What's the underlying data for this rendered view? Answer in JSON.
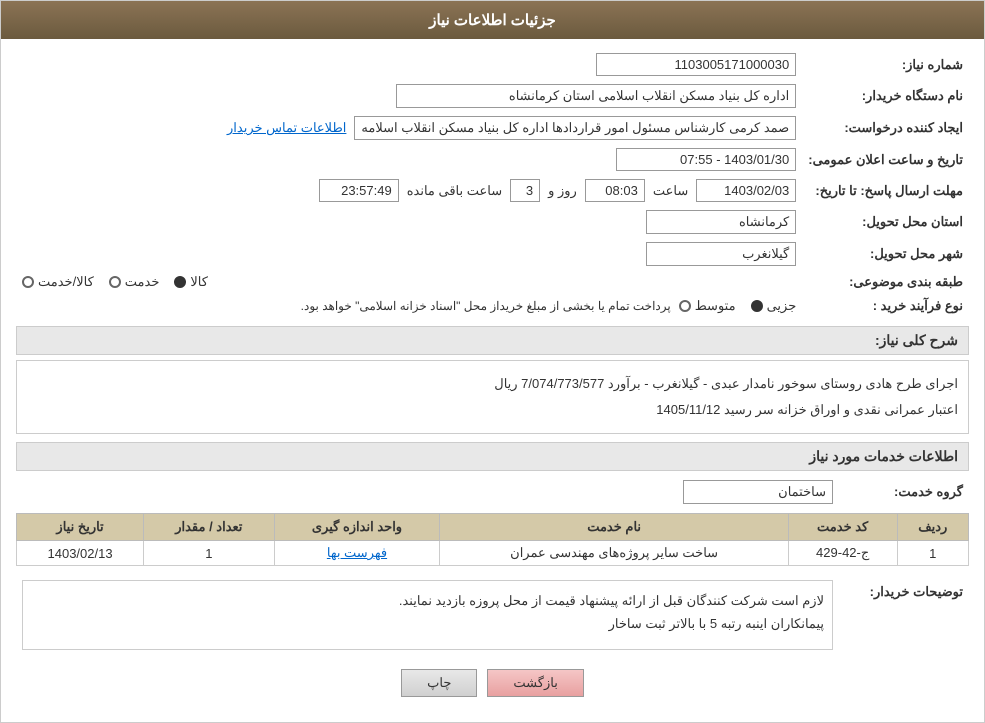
{
  "header": {
    "title": "جزئیات اطلاعات نیاز"
  },
  "fields": {
    "need_number_label": "شماره نیاز:",
    "need_number_value": "1103005171000030",
    "buyer_org_label": "نام دستگاه خریدار:",
    "buyer_org_value": "اداره کل بنیاد مسکن انقلاب اسلامی استان کرمانشاه",
    "requester_label": "ایجاد کننده درخواست:",
    "requester_value": "صمد کرمی کارشناس مسئول امور قراردادها اداره کل بنیاد مسکن انقلاب اسلامه",
    "requester_link": "اطلاعات تماس خریدار",
    "date_label": "تاریخ و ساعت اعلان عمومی:",
    "date_value": "1403/01/30 - 07:55",
    "response_deadline_label": "مهلت ارسال پاسخ: تا تاریخ:",
    "response_date_value": "1403/02/03",
    "response_time_label": "ساعت",
    "response_time_value": "08:03",
    "response_days_label": "روز و",
    "response_days_value": "3",
    "response_remaining_label": "ساعت باقی مانده",
    "response_remaining_value": "23:57:49",
    "province_label": "استان محل تحویل:",
    "province_value": "کرمانشاه",
    "city_label": "شهر محل تحویل:",
    "city_value": "گیلانغرب",
    "category_label": "طبقه بندی موضوعی:",
    "category_options": [
      "کالا",
      "خدمت",
      "کالا/خدمت"
    ],
    "category_selected": "کالا",
    "process_label": "نوع فرآیند خرید :",
    "process_options": [
      "جزیی",
      "متوسط"
    ],
    "process_note": "پرداخت تمام یا بخشی از مبلغ خریداز محل \"اسناد خزانه اسلامی\" خواهد بود.",
    "description_label": "شرح کلی نیاز:",
    "description_value": "اجرای طرح هادی روستای سوخور نامدار عبدی - گیلانغرب - برآورد 7/074/773/577 ریال\nاعتبار عمرانی نقدی و اوراق خزانه سر رسید 1405/11/12",
    "services_label": "اطلاعات خدمات مورد نیاز",
    "service_group_label": "گروه خدمت:",
    "service_group_value": "ساختمان",
    "table": {
      "headers": [
        "ردیف",
        "کد خدمت",
        "نام خدمت",
        "واحد اندازه گیری",
        "تعداد / مقدار",
        "تاریخ نیاز"
      ],
      "rows": [
        {
          "row": "1",
          "code": "ج-42-429",
          "name": "ساخت سایر پروژه‌های مهندسی عمران",
          "unit": "فهرست بها",
          "quantity": "1",
          "date": "1403/02/13"
        }
      ]
    },
    "buyer_notes_label": "توضیحات خریدار:",
    "buyer_notes_value": "لازم است شرکت کنندگان قبل از ارائه پیشنهاد قیمت از محل پروزه بازدید نمایند.\nپیمانکاران اینبه رتبه 5 با بالاتر ثبت ساخار"
  },
  "buttons": {
    "print_label": "چاپ",
    "back_label": "بازگشت"
  }
}
